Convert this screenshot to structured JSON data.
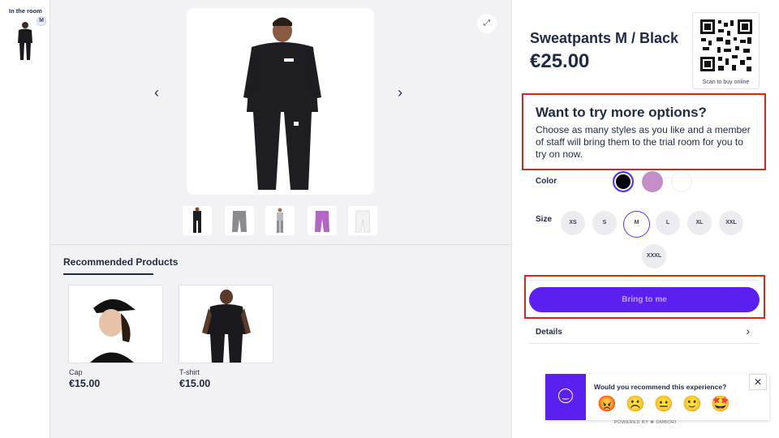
{
  "room": {
    "title": "In the room",
    "badge": "M"
  },
  "product": {
    "title": "Sweatpants M / Black",
    "price": "€25.00",
    "qr_caption": "Scan to buy online"
  },
  "promo": {
    "title": "Want to try more options?",
    "text": "Choose as many styles as you like and a member of staff will bring them to the trial room for you to try on now."
  },
  "options": {
    "color_label": "Color",
    "colors": [
      "#000000",
      "#c48fc8",
      "#ffffff"
    ],
    "size_label": "Size",
    "sizes": [
      "XS",
      "S",
      "M",
      "L",
      "XL",
      "XXL",
      "XXXL"
    ],
    "selected_size": "M"
  },
  "cta": {
    "label": "Bring to me"
  },
  "details": {
    "label": "Details"
  },
  "recommended": {
    "title": "Recommended Products",
    "items": [
      {
        "name": "Cap",
        "price": "€15.00"
      },
      {
        "name": "T-shirt",
        "price": "€15.00"
      }
    ]
  },
  "feedback": {
    "question": "Would you recommend this experience?",
    "emojis": [
      "😡",
      "☹️",
      "😐",
      "🙂",
      "🤩"
    ]
  },
  "footer": {
    "powered": "POWERED BY ❋ OMBORI"
  },
  "icons": {
    "prev": "chevron-left-icon",
    "next": "chevron-right-icon",
    "expand": "expand-icon",
    "close": "close-icon",
    "smile": "smile-icon"
  },
  "colors": {
    "accent": "#5b1ff0",
    "highlight": "#d9261c",
    "text": "#1f2a44"
  }
}
